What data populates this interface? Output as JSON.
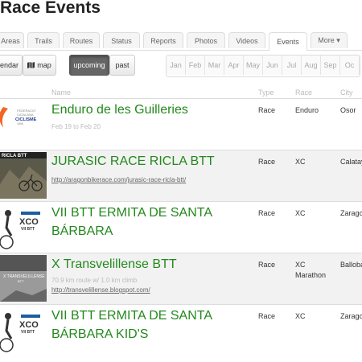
{
  "page_title": "Race Events",
  "tabs": [
    {
      "label": "Areas"
    },
    {
      "label": "Trails"
    },
    {
      "label": "Routes"
    },
    {
      "label": "Status"
    },
    {
      "label": "Reports"
    },
    {
      "label": "Photos"
    },
    {
      "label": "Videos"
    },
    {
      "label": "Events",
      "active": true
    },
    {
      "label": "More ▾"
    }
  ],
  "toolbar": {
    "calendar_label": "endar",
    "map_label": "map",
    "upcoming_label": "upcoming",
    "past_label": "past",
    "months": [
      "Jan",
      "Feb",
      "Mar",
      "Apr",
      "May",
      "Jun",
      "Jul",
      "Aug",
      "Sep",
      "Oc"
    ]
  },
  "table_headers": {
    "name": "Name",
    "type": "Type",
    "race": "Race",
    "city": "City"
  },
  "events": [
    {
      "name": "Enduro de les Guilleries",
      "dates": "Feb 19 to Feb 20",
      "type": "Race",
      "race": "Enduro",
      "city": "Osor",
      "thumb_icon": "federacio-catalana-ciclisme-logo"
    },
    {
      "name": "JURASIC RACE RICLA BTT",
      "link": "http://aragonbikerace.com/jurasic-race-ricla-btt/",
      "type": "Race",
      "race": "XC",
      "city": "Calatay",
      "thumb_icon": "ricla-btt-poster-image"
    },
    {
      "name": "VII BTT ERMITA DE SANTA BÁRBARA",
      "type": "Race",
      "race": "XC",
      "city": "Zaragoz",
      "thumb_icon": "xco-vii-btt-poster-image"
    },
    {
      "name": "X Transvelillense BTT",
      "distance": "70.9 km route w/ 1.0 km climb",
      "link": "http://transvelillense.blogspot.com/",
      "type": "Race",
      "race": "XC Marathon",
      "city": "Balloba",
      "thumb_icon": "transvelillense-poster-image"
    },
    {
      "name": "VII BTT ERMITA DE SANTA BÁRBARA KID'S",
      "type": "Race",
      "race": "XC",
      "city": "Zaragoz",
      "thumb_icon": "xco-vii-btt-kids-poster-image"
    }
  ]
}
